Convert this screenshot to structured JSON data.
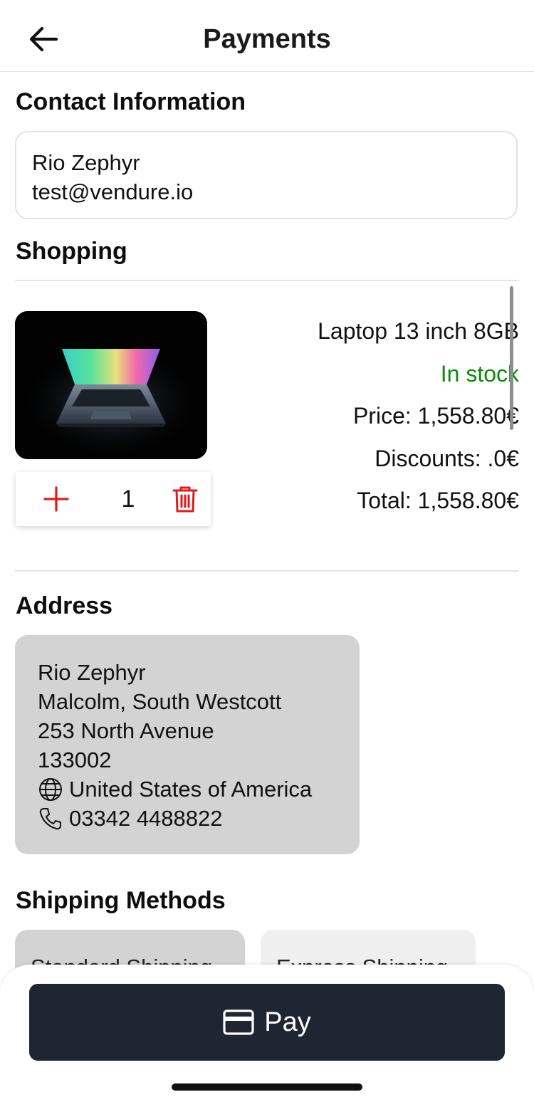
{
  "header": {
    "title": "Payments",
    "back_icon": "arrow-left-icon"
  },
  "contact": {
    "heading": "Contact Information",
    "name": "Rio Zephyr",
    "email": "test@vendure.io"
  },
  "shopping": {
    "heading": "Shopping",
    "product": {
      "name": "Laptop 13 inch 8GB",
      "stock": "In stock",
      "price": "Price: 1,558.80€",
      "discounts": "Discounts: .0€",
      "total": "Total: 1,558.80€",
      "quantity": "1"
    },
    "colors": {
      "stock": "#0c8a0c",
      "action": "#e01a1a"
    }
  },
  "address": {
    "heading": "Address",
    "name": "Rio Zephyr",
    "line1": "Malcolm, South Westcott",
    "line2": "253 North Avenue",
    "postal": "133002",
    "country": "United States of America",
    "phone": "03342 4488822"
  },
  "shipping_methods": {
    "heading": "Shipping Methods",
    "options": [
      {
        "label": "Standard Shipping"
      },
      {
        "label": "Express Shipping"
      }
    ]
  },
  "pay": {
    "label": "Pay",
    "icon": "credit-card-icon",
    "color": "#1f2633"
  }
}
